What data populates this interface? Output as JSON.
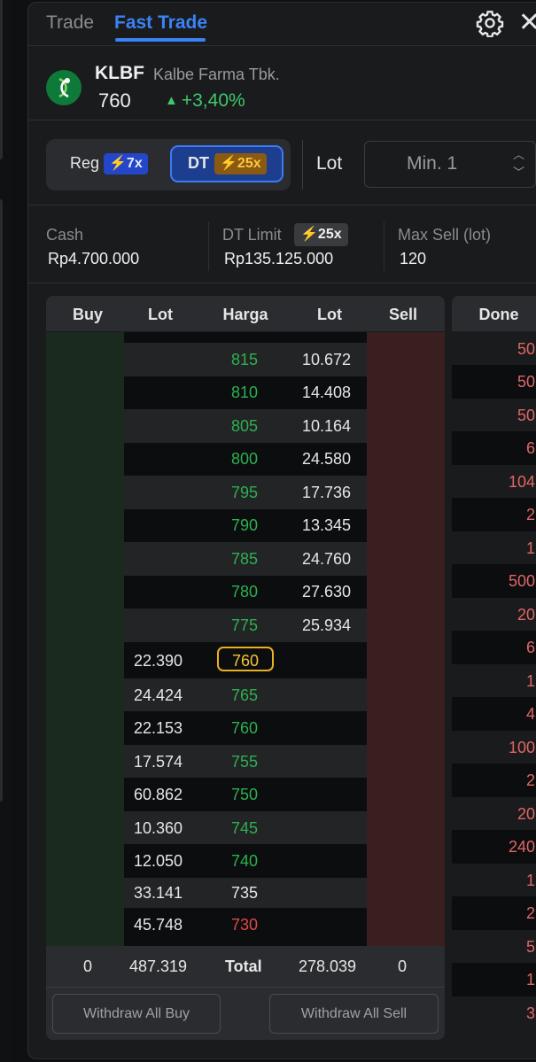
{
  "tabs": [
    {
      "label": "Trade"
    },
    {
      "label": "Fast Trade"
    }
  ],
  "icons": {
    "settings": "gear-icon",
    "close": "close-icon",
    "lightning": "lightning-icon",
    "trend": "triangle-up-icon"
  },
  "colors": {
    "accent": "#3b82f6",
    "up": "#3ec96a",
    "down": "#e04848",
    "highlight": "#e9b020"
  },
  "stock": {
    "ticker": "KLBF",
    "company": "Kalbe Farma Tbk.",
    "price": "760",
    "change": "+3,40%"
  },
  "trade_mode": {
    "reg_label": "Reg",
    "reg_leverage": "7x",
    "dt_label": "DT",
    "dt_leverage": "25x",
    "selected": "DT"
  },
  "lot_input": {
    "label": "Lot",
    "placeholder": "Min. 1"
  },
  "account": {
    "cash_label": "Cash",
    "cash_value": "Rp4.700.000",
    "dt_limit_label": "DT Limit",
    "dt_limit_badge": "25x",
    "dt_limit_value": "Rp135.125.000",
    "max_sell_label": "Max Sell (lot)",
    "max_sell_value": "120"
  },
  "orderbook": {
    "headers": {
      "buy": "Buy",
      "buy_lot": "Lot",
      "price": "Harga",
      "sell_lot": "Lot",
      "sell": "Sell",
      "done": "Done"
    },
    "offers": [
      {
        "price": "815",
        "lot": "10.672"
      },
      {
        "price": "810",
        "lot": "14.408"
      },
      {
        "price": "805",
        "lot": "10.164"
      },
      {
        "price": "800",
        "lot": "24.580"
      },
      {
        "price": "795",
        "lot": "17.736"
      },
      {
        "price": "790",
        "lot": "13.345"
      },
      {
        "price": "785",
        "lot": "24.760"
      },
      {
        "price": "780",
        "lot": "27.630"
      },
      {
        "price": "775",
        "lot": "25.934"
      }
    ],
    "bids": [
      {
        "price": "760",
        "lot": "22.390",
        "current": true
      },
      {
        "price": "765",
        "lot": "24.424"
      },
      {
        "price": "760",
        "lot": "22.153"
      },
      {
        "price": "755",
        "lot": "17.574"
      },
      {
        "price": "750",
        "lot": "60.862"
      },
      {
        "price": "745",
        "lot": "10.360"
      },
      {
        "price": "740",
        "lot": "12.050"
      },
      {
        "price": "735",
        "lot": "33.141"
      },
      {
        "price": "730",
        "lot": "45.748"
      }
    ],
    "done": [
      "50",
      "50",
      "50",
      "6",
      "104",
      "2",
      "1",
      "500",
      "20",
      "6",
      "1",
      "4",
      "100",
      "2",
      "20",
      "240",
      "1",
      "2",
      "5",
      "1",
      "3"
    ],
    "totals": {
      "buy": "0",
      "buy_lot": "487.319",
      "label": "Total",
      "sell_lot": "278.039",
      "sell": "0"
    }
  },
  "actions": {
    "withdraw_buy": "Withdraw All Buy",
    "withdraw_sell": "Withdraw All Sell"
  }
}
